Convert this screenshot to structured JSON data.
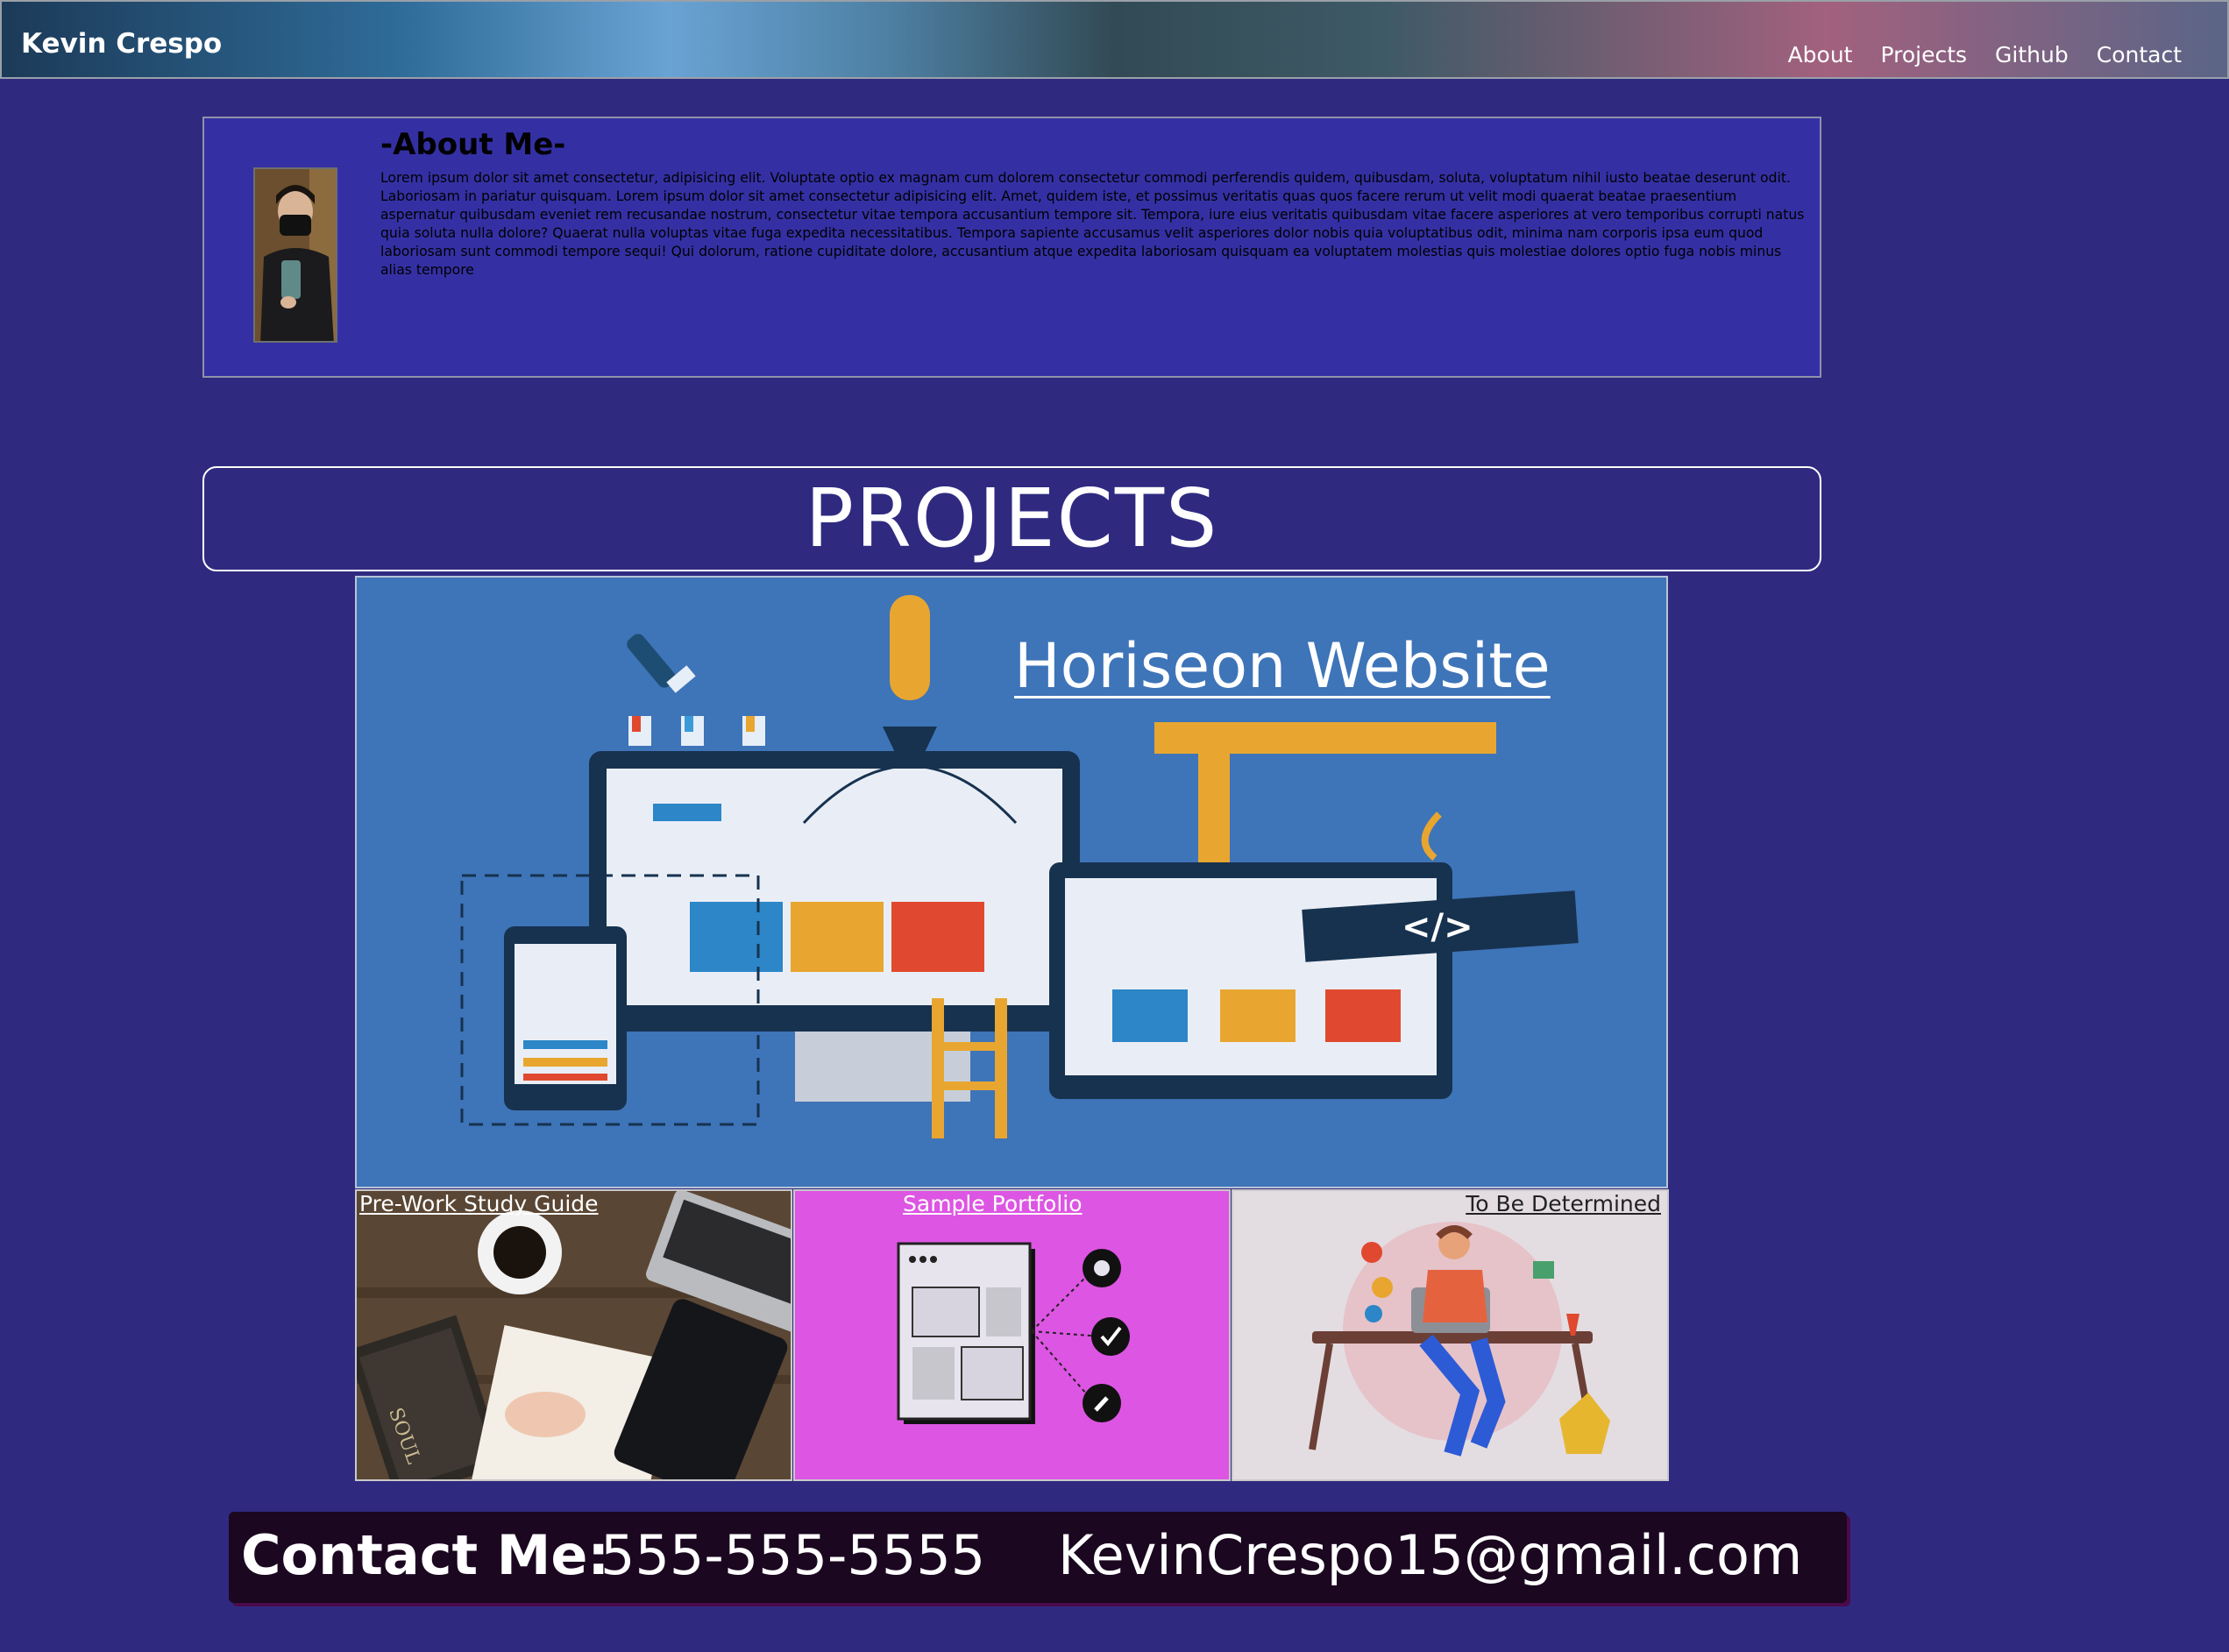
{
  "header": {
    "brand": "Kevin Crespo",
    "nav": [
      "About",
      "Projects",
      "Github",
      "Contact"
    ]
  },
  "about": {
    "heading": "-About Me-",
    "body": "Lorem ipsum dolor sit amet consectetur, adipisicing elit. Voluptate optio ex magnam cum dolorem consectetur commodi perferendis quidem, quibusdam, soluta, voluptatum nihil iusto beatae deserunt odit. Laboriosam in pariatur quisquam. Lorem ipsum dolor sit amet consectetur adipisicing elit. Amet, quidem iste, et possimus veritatis quas quos facere rerum ut velit modi quaerat beatae praesentium aspernatur quibusdam eveniet rem recusandae nostrum, consectetur vitae tempora accusantium tempore sit. Tempora, iure eius veritatis quibusdam vitae facere asperiores at vero temporibus corrupti natus quia soluta nulla dolore? Quaerat nulla voluptas vitae fuga expedita necessitatibus. Tempora sapiente accusamus velit asperiores dolor nobis quia voluptatibus odit, minima nam corporis ipsa eum quod laboriosam sunt commodi tempore sequi! Qui dolorum, ratione cupiditate dolore, accusantium atque expedita laboriosam quisquam ea voluptatem molestias quis molestiae dolores optio fuga nobis minus alias tempore"
  },
  "projects": {
    "heading": "PROJECTS",
    "featured": {
      "title": "Horiseon Website",
      "code_badge": "</>"
    },
    "tiles": [
      {
        "label": "Pre-Work Study Guide",
        "book_text": "SOUL"
      },
      {
        "label": "Sample Portfolio"
      },
      {
        "label": "To Be Determined"
      }
    ]
  },
  "contact": {
    "label": "Contact Me:",
    "phone": "555-555-5555",
    "email": "KevinCrespo15@gmail.com"
  },
  "colors": {
    "page_bg": "#2f2a80",
    "about_bg": "#3430a4",
    "feature_bg": "#3e74b8",
    "portfolio_bg": "#dd55e3",
    "contact_bg": "#1b0720"
  }
}
